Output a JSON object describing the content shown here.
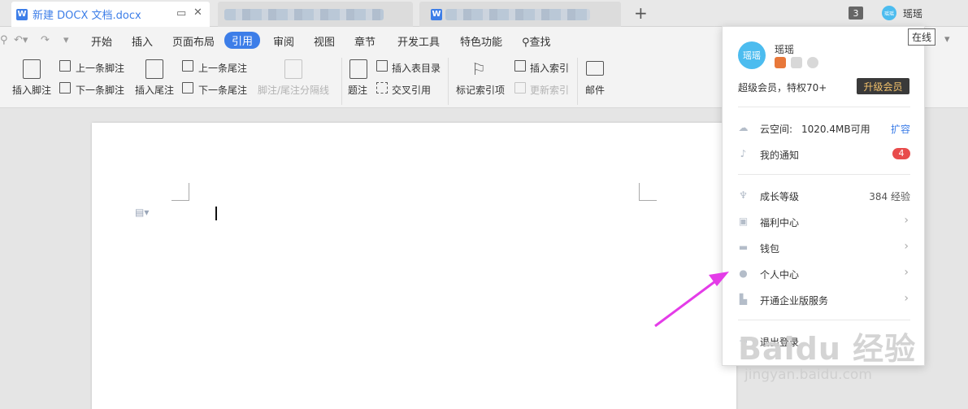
{
  "tabs": [
    {
      "title": "新建 DOCX 文档.docx",
      "logo": "W"
    },
    {
      "title": "",
      "logo": ""
    },
    {
      "title": "",
      "logo": "W"
    }
  ],
  "tabbar": {
    "plus": "+",
    "count": "3",
    "avatar_text": "瑶瑶",
    "username": "瑶瑶"
  },
  "tooltip": "在线",
  "menu": [
    "开始",
    "插入",
    "页面布局",
    "引用",
    "审阅",
    "视图",
    "章节",
    "开发工具",
    "特色功能",
    "查找"
  ],
  "ribbon": {
    "insert_footnote": "插入脚注",
    "prev_footnote": "上一条脚注",
    "next_footnote": "下一条脚注",
    "insert_endnote": "插入尾注",
    "prev_endnote": "上一条尾注",
    "next_endnote": "下一条尾注",
    "separator": "脚注/尾注分隔线",
    "insert_toc": "插入表目录",
    "caption": "题注",
    "cross_ref": "交叉引用",
    "mark_index": "标记索引项",
    "insert_index": "插入索引",
    "update_index": "更新索引",
    "mail": "邮件"
  },
  "account": {
    "avatar_text": "瑶瑶",
    "name": "瑶瑶",
    "vip_text": "超级会员，特权70+",
    "upgrade": "升级会员",
    "cloud_label": "云空间:",
    "cloud_value": "1020.4MB可用",
    "expand": "扩容",
    "notify_label": "我的通知",
    "notify_count": "4",
    "growth_label": "成长等级",
    "growth_value": "384 经验",
    "welfare": "福利中心",
    "wallet": "钱包",
    "personal": "个人中心",
    "enterprise": "开通企业版服务",
    "logout": "退出登录"
  },
  "watermark": {
    "brand": "Baidu 经验",
    "url": "jingyan.baidu.com"
  },
  "colors": {
    "accent": "#3d7ee8",
    "arrow": "#e43ce8",
    "badge": "#e84c4c"
  }
}
